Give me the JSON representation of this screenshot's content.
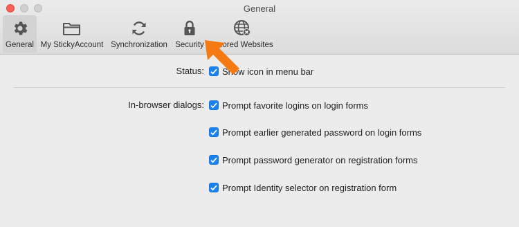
{
  "window": {
    "title": "General"
  },
  "toolbar": {
    "tabs": [
      {
        "label": "General",
        "icon": "gear-icon",
        "selected": true
      },
      {
        "label": "My StickyAccount",
        "icon": "folder-icon",
        "selected": false
      },
      {
        "label": "Synchronization",
        "icon": "sync-icon",
        "selected": false
      },
      {
        "label": "Security",
        "icon": "lock-icon",
        "selected": false
      },
      {
        "label": "Ignored Websites",
        "icon": "globe-blocked-icon",
        "selected": false
      }
    ]
  },
  "status": {
    "label": "Status:",
    "option": {
      "text": "Show icon in menu bar",
      "checked": true
    }
  },
  "dialogs": {
    "label": "In-browser dialogs:",
    "options": [
      {
        "text": "Prompt favorite logins on login forms",
        "checked": true
      },
      {
        "text": "Prompt earlier generated password on login forms",
        "checked": true
      },
      {
        "text": "Prompt password generator on registration forms",
        "checked": true
      },
      {
        "text": "Prompt Identity selector on registration form",
        "checked": true
      }
    ]
  },
  "colors": {
    "checkbox_accent": "#1b82f2",
    "arrow": "#f57a14",
    "close_button": "#fc5f57"
  },
  "overlay": {
    "icon": "orange-pointer-arrow"
  }
}
